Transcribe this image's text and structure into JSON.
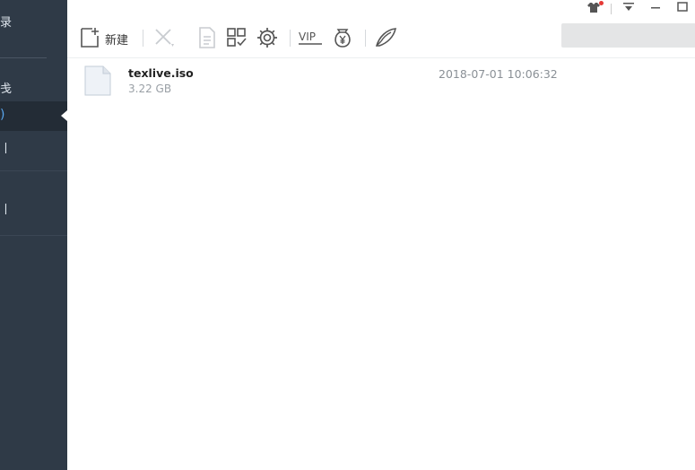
{
  "sidebar": {
    "items": [
      {
        "label": "录"
      },
      {
        "label": "戋"
      },
      {
        "label": ")"
      },
      {
        "label": "丨"
      },
      {
        "label": "丨"
      }
    ]
  },
  "toolbar": {
    "new_label": "新建",
    "vip_label": "VIP",
    "search_placeholder": ""
  },
  "files": [
    {
      "name": "texlive.iso",
      "size": "3.22 GB",
      "date": "2018-07-01 10:06:32"
    }
  ],
  "colors": {
    "sidebar_bg": "#2f3a47",
    "active_text": "#59a6ee",
    "notification_dot": "#e53935"
  }
}
